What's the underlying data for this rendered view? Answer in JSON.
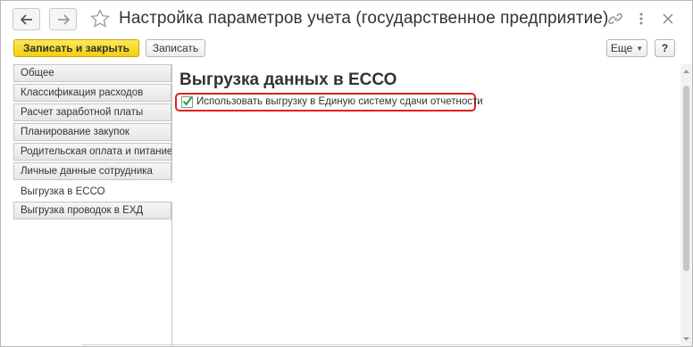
{
  "window": {
    "title": "Настройка параметров учета (государственное предприятие)"
  },
  "titlebar": {
    "icons": [
      "back-arrow-icon",
      "forward-arrow-icon",
      "star-icon",
      "link-icon",
      "more-vertical-icon",
      "close-icon"
    ]
  },
  "toolbar": {
    "save_close_label": "Записать и закрыть",
    "save_label": "Записать",
    "more_label": "Еще",
    "help_label": "?"
  },
  "sidebar": {
    "items": [
      {
        "label": "Общее"
      },
      {
        "label": "Классификация расходов"
      },
      {
        "label": "Расчет заработной платы"
      },
      {
        "label": "Планирование закупок"
      },
      {
        "label": "Родительская оплата и питание"
      },
      {
        "label": "Личные данные сотрудника"
      },
      {
        "label": "Выгрузка в ЕССО"
      },
      {
        "label": "Выгрузка проводок в ЕХД"
      }
    ],
    "active_index": 6
  },
  "main": {
    "heading": "Выгрузка данных в  ЕССО",
    "checkbox": {
      "label": "Использовать выгрузку в  Единую систему сдачи отчетности",
      "checked": true
    }
  },
  "colors": {
    "primary_button": "#f5d31a",
    "highlight_border": "#e02020",
    "checkmark": "#2e9a2e"
  }
}
